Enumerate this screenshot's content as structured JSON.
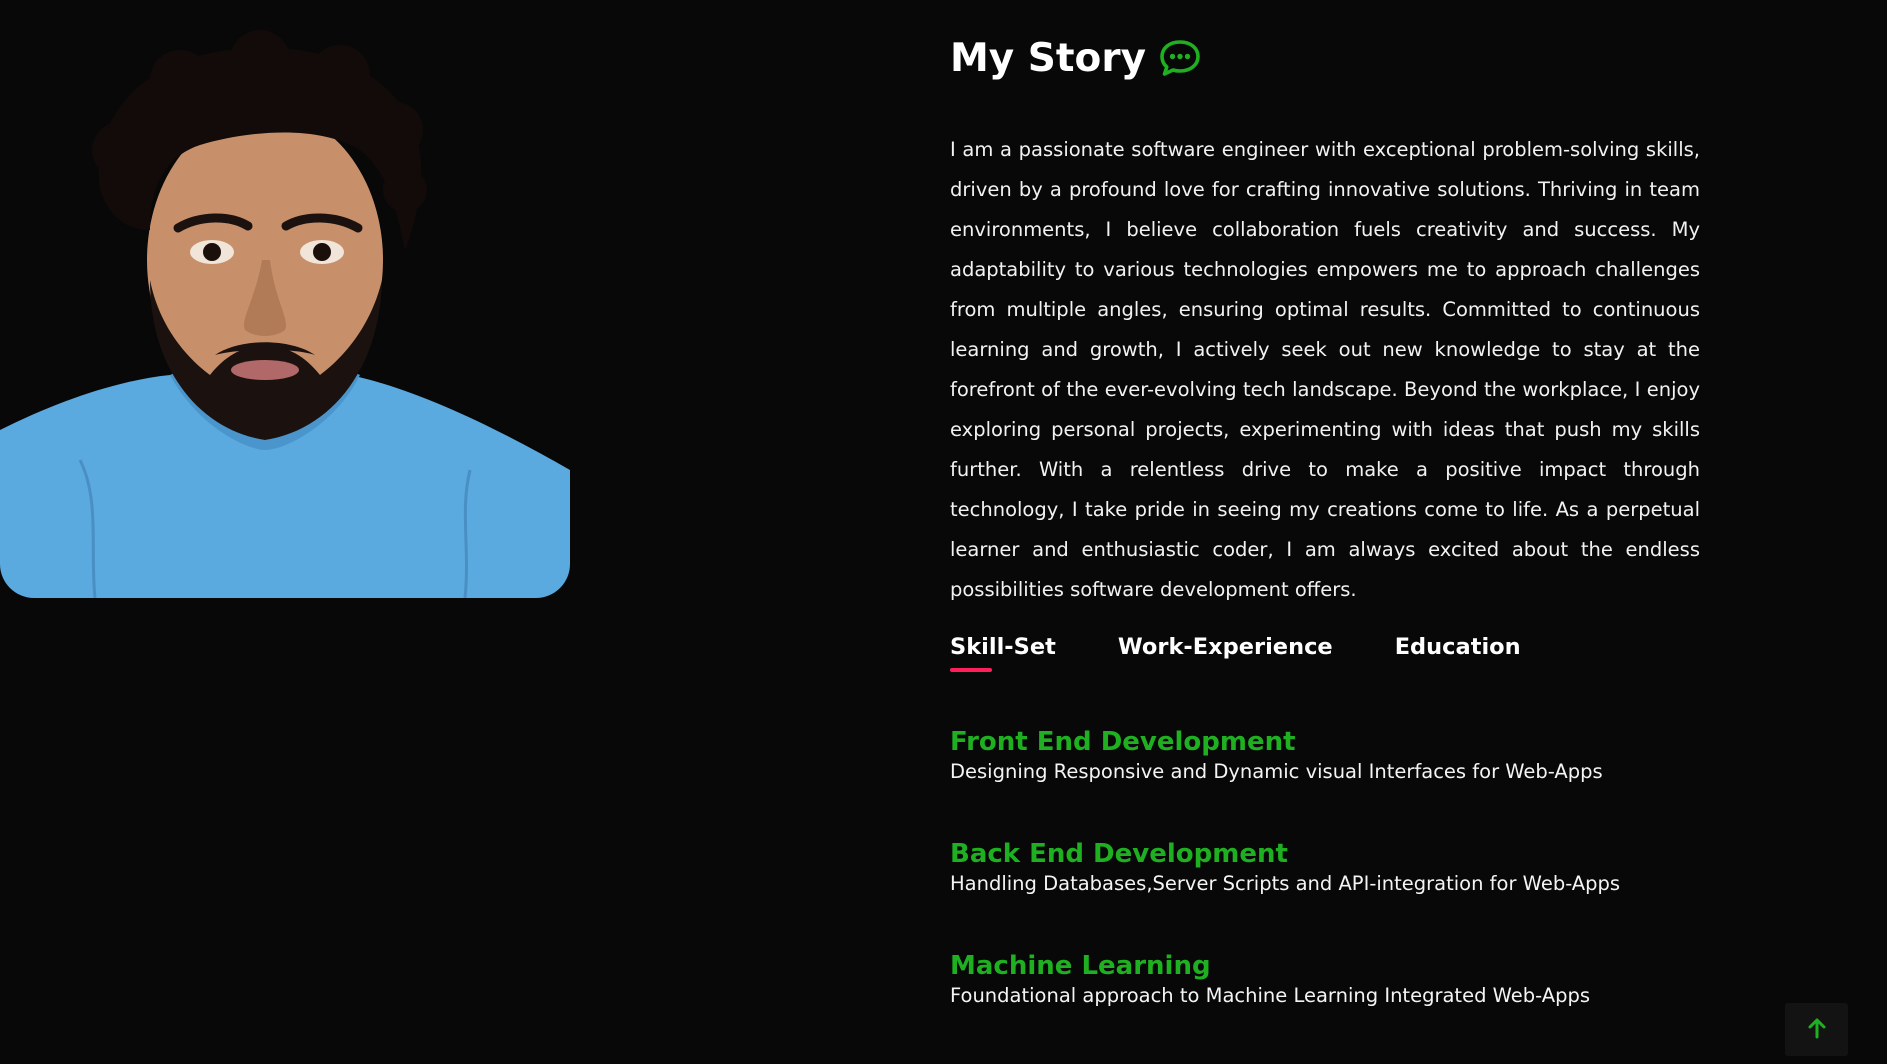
{
  "story": {
    "title": "My Story",
    "title_icon": "chat-bubble-icon",
    "paragraph": "I am a passionate software engineer with exceptional problem-solving skills, driven by a profound love for crafting innovative solutions. Thriving in team environments, I believe collaboration fuels creativity and success. My adaptability to various technologies empowers me to approach challenges from multiple angles, ensuring optimal results. Committed to continuous learning and growth, I actively seek out new knowledge to stay at the forefront of the ever-evolving tech landscape. Beyond the workplace, I enjoy exploring personal projects, experimenting with ideas that push my skills further. With a relentless drive to make a positive impact through technology, I take pride in seeing my creations come to life. As a perpetual learner and enthusiastic coder, I am always excited about the endless possibilities software development offers."
  },
  "tabs": [
    {
      "label": "Skill-Set",
      "active": true
    },
    {
      "label": "Work-Experience",
      "active": false
    },
    {
      "label": "Education",
      "active": false
    }
  ],
  "skills": [
    {
      "title": "Front End Development",
      "description": "Designing Responsive and Dynamic visual Interfaces for Web-Apps"
    },
    {
      "title": "Back End Development",
      "description": "Handling Databases,Server Scripts and API-integration for Web-Apps"
    },
    {
      "title": "Machine Learning",
      "description": "Foundational approach to Machine Learning Integrated Web-Apps"
    }
  ],
  "colors": {
    "background": "#080808",
    "accent_green": "#1fb021",
    "tab_underline": "#ff1f5c"
  },
  "back_to_top": {
    "icon": "arrow-up-icon"
  }
}
